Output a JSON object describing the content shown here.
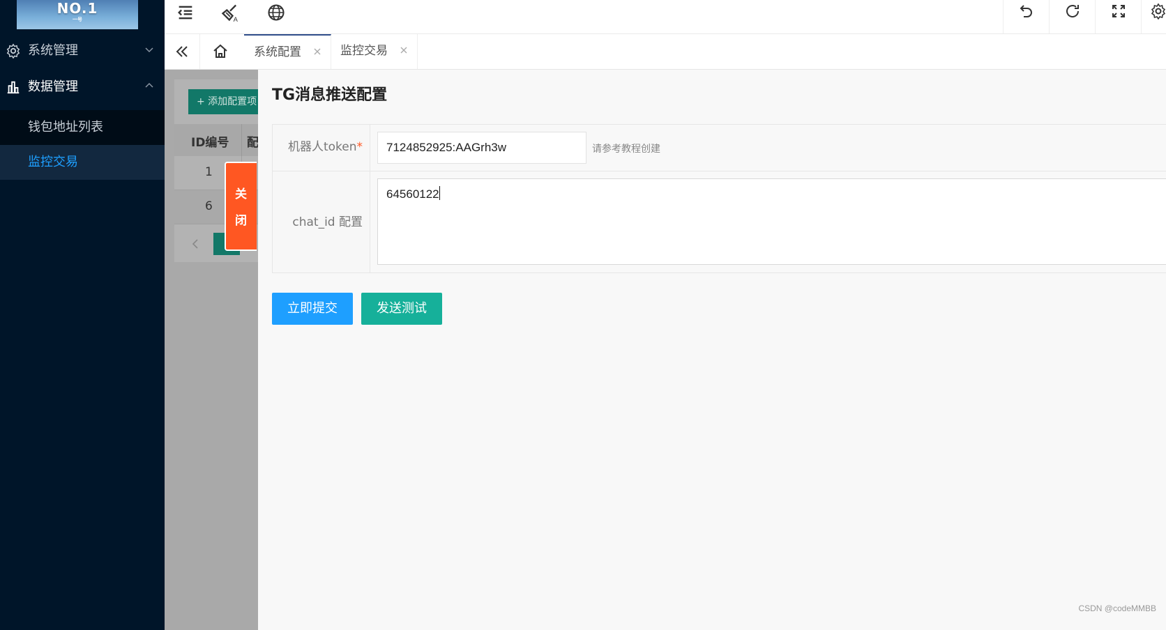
{
  "sidebar": {
    "logo": {
      "main": "NO.1",
      "sub": "一号"
    },
    "groups": [
      {
        "label": "系统管理",
        "icon": "gear-icon",
        "expanded": false
      },
      {
        "label": "数据管理",
        "icon": "chart-icon",
        "expanded": true
      }
    ],
    "items": [
      {
        "label": "钱包地址列表",
        "active": false
      },
      {
        "label": "监控交易",
        "active": true
      }
    ]
  },
  "header": {
    "left_icons": [
      "menu-collapse-icon",
      "clear-cache-icon",
      "globe-icon"
    ],
    "right_icons": [
      "undo-icon",
      "refresh-icon",
      "fullscreen-icon",
      "settings-icon"
    ]
  },
  "tabs": {
    "items": [
      {
        "label": "系统配置",
        "active": true
      },
      {
        "label": "监控交易",
        "active": false
      }
    ]
  },
  "background_table": {
    "add_button": "+ 添加配置项",
    "headers": [
      "ID编号",
      "配"
    ],
    "rows": [
      "1",
      "6"
    ]
  },
  "close_button": {
    "char1": "关",
    "char2": "闭"
  },
  "panel": {
    "title": "TG消息推送配置",
    "fields": {
      "token": {
        "label": "机器人token",
        "required_mark": "*",
        "value": "7124852925:AAGrh3w",
        "hint": "请参考教程创建"
      },
      "chat_id": {
        "label": "chat_id 配置",
        "value": "64560122"
      }
    },
    "buttons": {
      "submit": "立即提交",
      "test": "发送测试"
    }
  },
  "watermark": "CSDN @codeMMBB",
  "colors": {
    "sidebar_bg": "#001529",
    "accent": "#1e9fff",
    "teal": "#16b09a",
    "close": "#ff5722"
  }
}
